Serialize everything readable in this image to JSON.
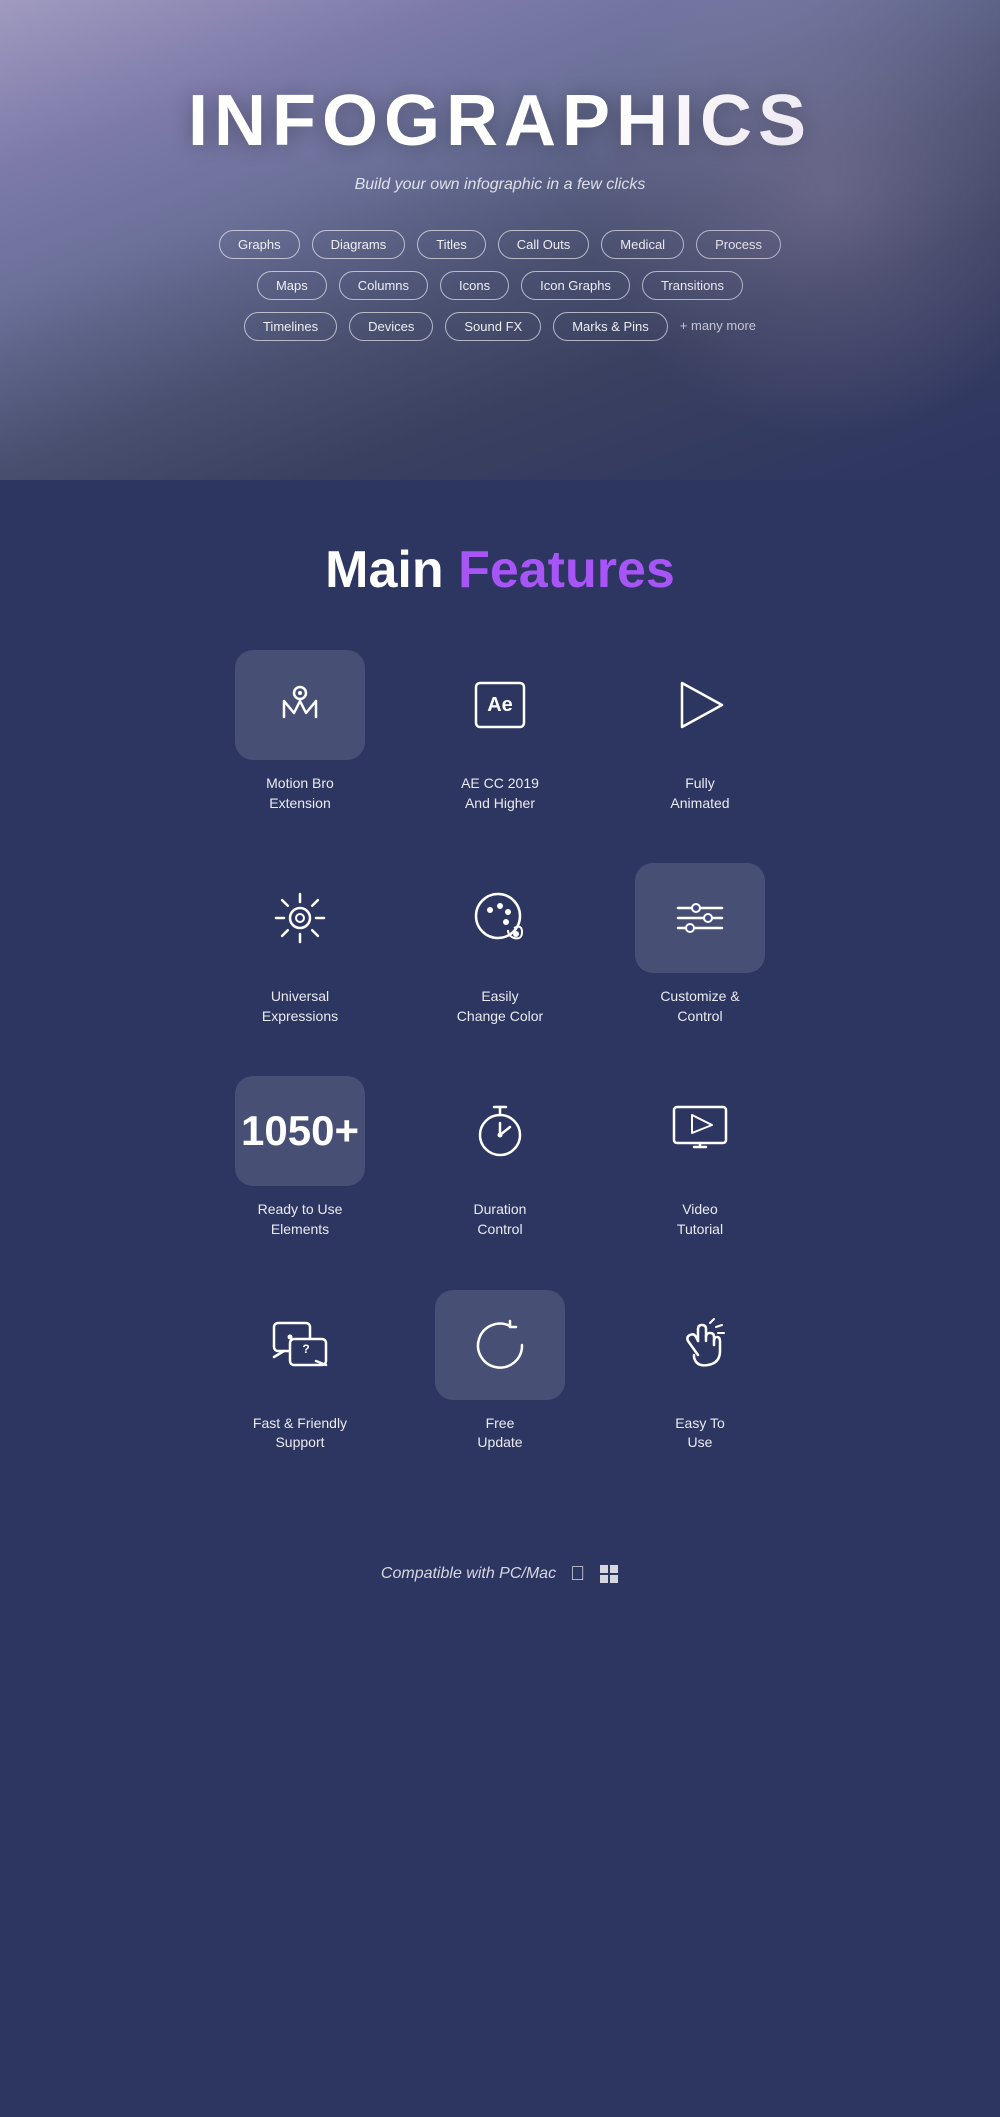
{
  "hero": {
    "title": "INFOGRAPHICS",
    "subtitle": "Build your own infographic in a few clicks",
    "tags_row1": [
      "Graphs",
      "Diagrams",
      "Titles",
      "Call Outs",
      "Medical",
      "Process"
    ],
    "tags_row2": [
      "Maps",
      "Columns",
      "Icons",
      "Icon Graphs",
      "Transitions"
    ],
    "tags_row3": [
      "Timelines",
      "Devices",
      "Sound FX",
      "Marks & Pins"
    ],
    "tags_more": "+ many more"
  },
  "features": {
    "section_title_white": "Main ",
    "section_title_purple": "Features",
    "items": [
      {
        "label": "Motion Bro\nExtension",
        "icon": "motion-bro",
        "highlighted": true
      },
      {
        "label": "AE CC 2019\nAnd Higher",
        "icon": "ae-logo",
        "highlighted": false
      },
      {
        "label": "Fully\nAnimated",
        "icon": "play",
        "highlighted": false
      },
      {
        "label": "Universal\nExpressions",
        "icon": "gear",
        "highlighted": false
      },
      {
        "label": "Easily\nChange Color",
        "icon": "palette",
        "highlighted": false
      },
      {
        "label": "Customize &\nControl",
        "icon": "sliders",
        "highlighted": true
      },
      {
        "label": "1050+\nReady to Use\nElements",
        "icon": "number",
        "highlighted": true
      },
      {
        "label": "Duration\nControl",
        "icon": "timer",
        "highlighted": false
      },
      {
        "label": "Video\nTutorial",
        "icon": "monitor-play",
        "highlighted": false
      },
      {
        "label": "Fast & Friendly\nSupport",
        "icon": "chat",
        "highlighted": false
      },
      {
        "label": "Free\nUpdate",
        "icon": "refresh",
        "highlighted": true
      },
      {
        "label": "Easy To\nUse",
        "icon": "hand",
        "highlighted": false
      }
    ]
  },
  "compatible": {
    "text": "Compatible with PC/Mac"
  }
}
